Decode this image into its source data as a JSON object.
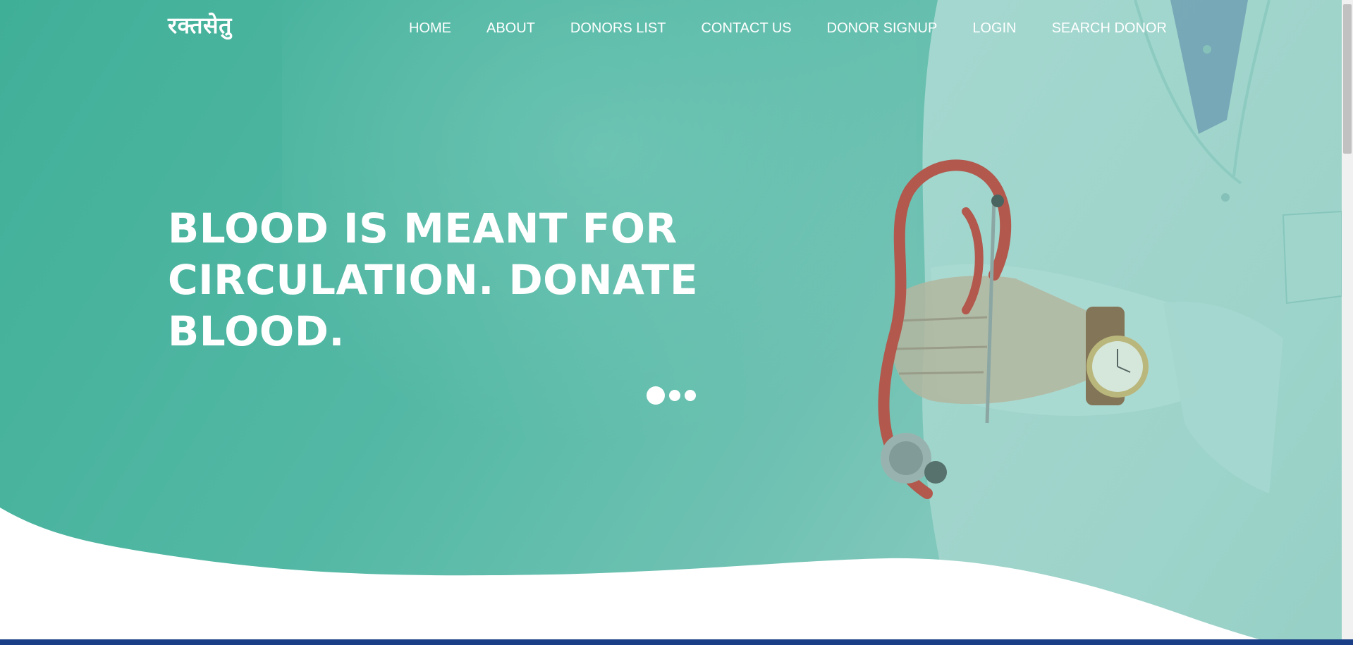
{
  "brand": {
    "logo_text": "रक्तसेतु"
  },
  "nav": {
    "items": [
      {
        "label": "HOME"
      },
      {
        "label": "ABOUT"
      },
      {
        "label": "DONORS LIST"
      },
      {
        "label": "CONTACT US"
      },
      {
        "label": "DONOR SIGNUP"
      },
      {
        "label": "LOGIN"
      },
      {
        "label": "SEARCH DONOR"
      }
    ]
  },
  "hero": {
    "headline": "BLOOD IS MEANT FOR CIRCULATION. DONATE BLOOD.",
    "carousel": {
      "slide_count": 3,
      "active_index": 0
    }
  },
  "colors": {
    "teal_primary": "#4db5a0",
    "teal_light": "#8fd0c6",
    "stethoscope_red": "#c8443a",
    "footer_strip": "#1a3f86",
    "text_white": "#ffffff"
  },
  "icons": {
    "hero_illustration": "doctor-with-stethoscope"
  }
}
